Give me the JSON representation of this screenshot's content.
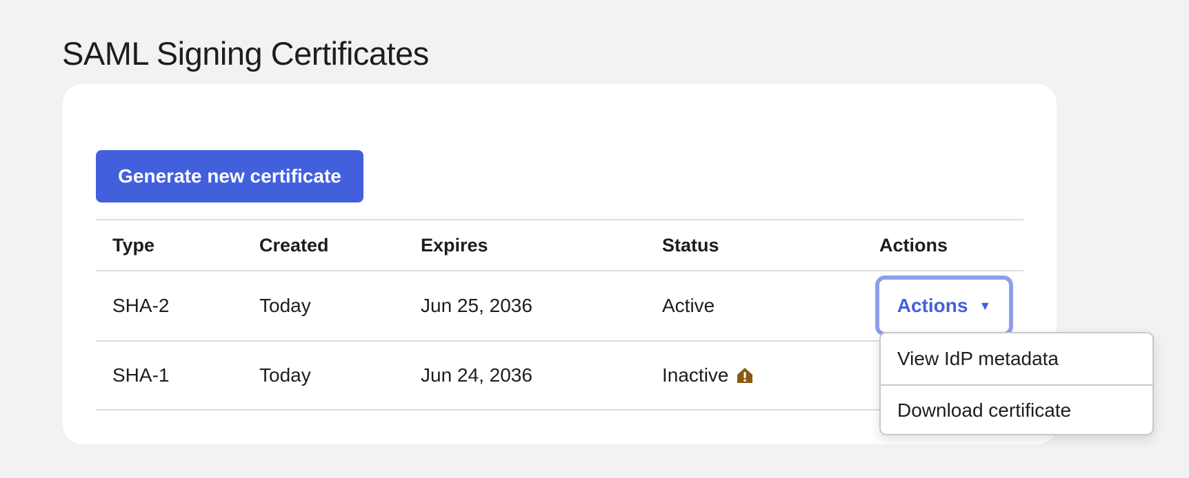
{
  "page": {
    "title": "SAML Signing Certificates"
  },
  "toolbar": {
    "generate_label": "Generate new certificate"
  },
  "table": {
    "headers": {
      "type": "Type",
      "created": "Created",
      "expires": "Expires",
      "status": "Status",
      "actions": "Actions"
    },
    "rows": [
      {
        "type": "SHA-2",
        "created": "Today",
        "expires": "Jun 25, 2036",
        "status": "Active",
        "warning": false
      },
      {
        "type": "SHA-1",
        "created": "Today",
        "expires": "Jun 24, 2036",
        "status": "Inactive",
        "warning": true,
        "warning_icon": "warning-icon"
      }
    ],
    "actions_button": {
      "label": "Actions",
      "caret": "▼"
    }
  },
  "menu": {
    "items": [
      {
        "label": "View IdP metadata"
      },
      {
        "label": "Download certificate"
      }
    ]
  },
  "colors": {
    "accent": "#4360dc",
    "focus_ring": "#8e9ee9",
    "warning": "#8a5a14",
    "background": "#f2f2f2",
    "card": "#ffffff"
  }
}
